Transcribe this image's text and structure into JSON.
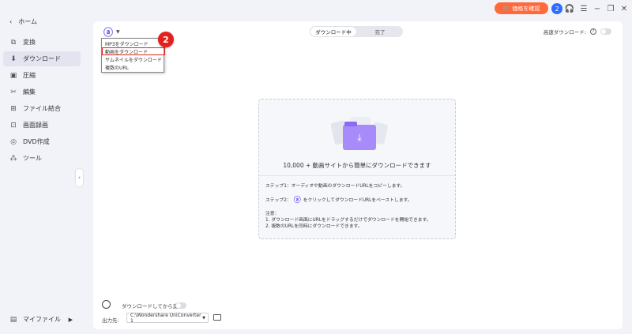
{
  "titlebar": {
    "buy_label": "価格を確認",
    "avatar_initial": "2"
  },
  "sidebar": {
    "home_label": "ホーム",
    "items": [
      {
        "label": "変換",
        "icon": "convert-icon"
      },
      {
        "label": "ダウンロード",
        "icon": "download-icon",
        "active": true
      },
      {
        "label": "圧縮",
        "icon": "compress-icon"
      },
      {
        "label": "編集",
        "icon": "scissors-icon"
      },
      {
        "label": "ファイル結合",
        "icon": "merge-icon"
      },
      {
        "label": "画面録画",
        "icon": "screen-record-icon"
      },
      {
        "label": "DVD作成",
        "icon": "dvd-icon"
      },
      {
        "label": "ツール",
        "icon": "tools-icon"
      }
    ],
    "myfile_label": "マイファイル"
  },
  "main": {
    "tabs": [
      "ダウンロード中",
      "完了"
    ],
    "active_tab": 0,
    "hispeed_label": "高速ダウンロード:",
    "dropdown": [
      "MP3をダウンロード",
      "動画をダウンロード",
      "サムネイルをダウンロード",
      "複数のURL"
    ],
    "highlighted_item": 1,
    "badge_number": "2",
    "headline": "10,000 + 動画サイトから簡単にダウンロードできます",
    "step1": "ステップ1：オーディオや動画のダウンロードURLをコピーします。",
    "step2_prefix": "ステップ2：",
    "step2_suffix": "をクリックしてダウンロードURLをペーストします。",
    "note_title": "注意：",
    "note1": "1. ダウンロード画面にURLをドラッグするだけでダウンロードを開始できます。",
    "note2": "2. 複数のURLを同時にダウンロードできます。",
    "convert_after_label": "ダウンロードしてから変換:",
    "output_label": "出力先:",
    "output_path": "C:\\Wondershare UniConverter 1"
  },
  "colors": {
    "accent": "#6b5ce7",
    "buy": "#ff6a3d",
    "badge": "#e3201b",
    "highlight_border": "#e0271b"
  }
}
